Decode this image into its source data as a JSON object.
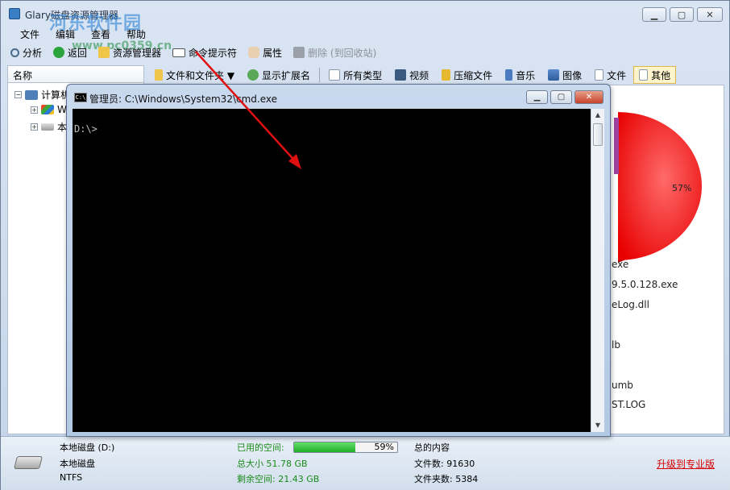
{
  "window": {
    "title": "Glary磁盘资源管理器",
    "minimize": "▁",
    "maximize": "▢",
    "close": "✕"
  },
  "watermark": {
    "brand": "河东软件园",
    "url": "www.pc0359.cn"
  },
  "menu": [
    "文件",
    "编辑",
    "查看",
    "帮助"
  ],
  "toolbar": {
    "analyze": "分析",
    "back": "返回",
    "explorer": "资源管理器",
    "cmd": "命令提示符",
    "props": "属性",
    "delete": "删除 (到回收站)"
  },
  "tree": {
    "header": "名称",
    "root": "计算机",
    "child1": "W",
    "child2": "本"
  },
  "filters": {
    "files_folders": "文件和文件夹 ▼",
    "show_ext": "显示扩展名",
    "all_types": "所有类型",
    "video": "视频",
    "archive": "压缩文件",
    "music": "音乐",
    "image": "图像",
    "document": "文件",
    "other": "其他"
  },
  "content": {
    "pie_label": "57%",
    "files": [
      "exe",
      "9.5.0.128.exe",
      "eLog.dll",
      "lb",
      "umb",
      "ST.LOG"
    ]
  },
  "cmd": {
    "title": "管理员: C:\\Windows\\System32\\cmd.exe",
    "icon": "C:\\",
    "prompt": "D:\\>",
    "minimize": "▁",
    "maximize": "▢",
    "close": "✕"
  },
  "status": {
    "drive_name": "本地磁盘 (D:)",
    "drive_type": "本地磁盘",
    "fs": "NTFS",
    "used_label": "已用的空间:",
    "used_percent": "59%",
    "used_fraction": 0.59,
    "total_size": "总大小 51.78 GB",
    "free_space": "剩余空间: 21.43 GB",
    "summary_title": "总的内容",
    "file_count": "文件数: 91630",
    "folder_count": "文件夹数: 5384",
    "upgrade": "升级到专业版"
  },
  "colors": {
    "pie": "#ff2020",
    "progress": "#28b830",
    "upgrade": "#d60000",
    "arrow": "#e01010"
  }
}
